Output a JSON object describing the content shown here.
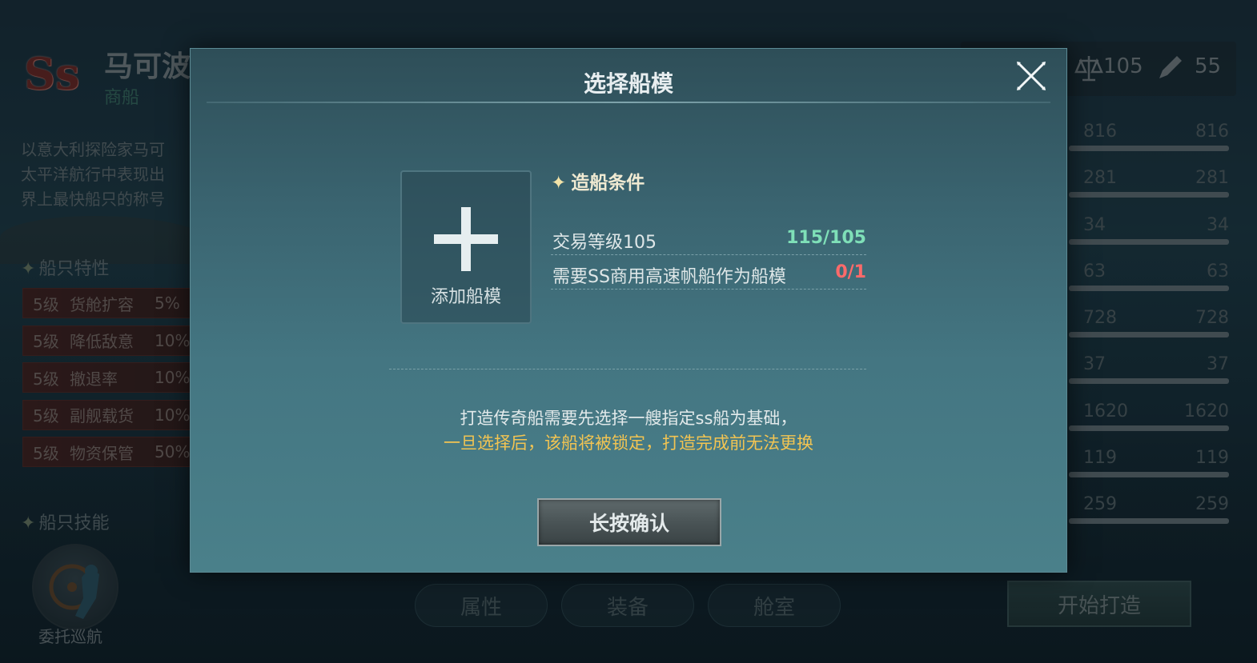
{
  "background": {
    "ship": {
      "rank": "Ss",
      "name": "马可波罗号",
      "type": "商船",
      "description": "以意大利探险家马可\n太平洋航行中表现出\n界上最快船只的称号"
    },
    "traits_heading": "船只特性",
    "traits": [
      {
        "level": "5级",
        "name": "货舱扩容",
        "value": "5%"
      },
      {
        "level": "5级",
        "name": "降低敌意",
        "value": "10%"
      },
      {
        "level": "5级",
        "name": "撤退率",
        "value": "10%"
      },
      {
        "level": "5级",
        "name": "副舰载货",
        "value": "10%"
      },
      {
        "level": "5级",
        "name": "物资保管",
        "value": "50%"
      }
    ],
    "skills_heading": "船只技能",
    "skill_label": "委托巡航",
    "header_stats": {
      "balance": "105",
      "pen": "55"
    },
    "stats": [
      {
        "current": "816",
        "max": "816"
      },
      {
        "current": "281",
        "max": "281"
      },
      {
        "current": "34",
        "max": "34"
      },
      {
        "current": "63",
        "max": "63"
      },
      {
        "current": "728",
        "max": "728"
      },
      {
        "current": "37",
        "max": "37"
      },
      {
        "current": "1620",
        "max": "1620"
      },
      {
        "current": "119",
        "max": "119"
      },
      {
        "current": "259",
        "max": "259"
      }
    ],
    "tabs": [
      "属性",
      "装备",
      "舱室"
    ],
    "start_button": "开始打造"
  },
  "dialog": {
    "title": "选择船模",
    "add_slot_label": "添加船模",
    "conditions_heading": "造船条件",
    "conditions": [
      {
        "label": "交易等级105",
        "value": "115/105",
        "status": "ok"
      },
      {
        "label": "需要SS商用高速帆船作为船模",
        "value": "0/1",
        "status": "unmet"
      }
    ],
    "hint_line1": "打造传奇船需要先选择一艘指定ss船为基础，",
    "hint_line2": "一旦选择后，该船将被锁定，打造完成前无法更换",
    "confirm_button": "长按确认"
  },
  "colors": {
    "ok": "#7fe0b8",
    "unmet": "#ff6a6a",
    "warning": "#f2c452"
  }
}
